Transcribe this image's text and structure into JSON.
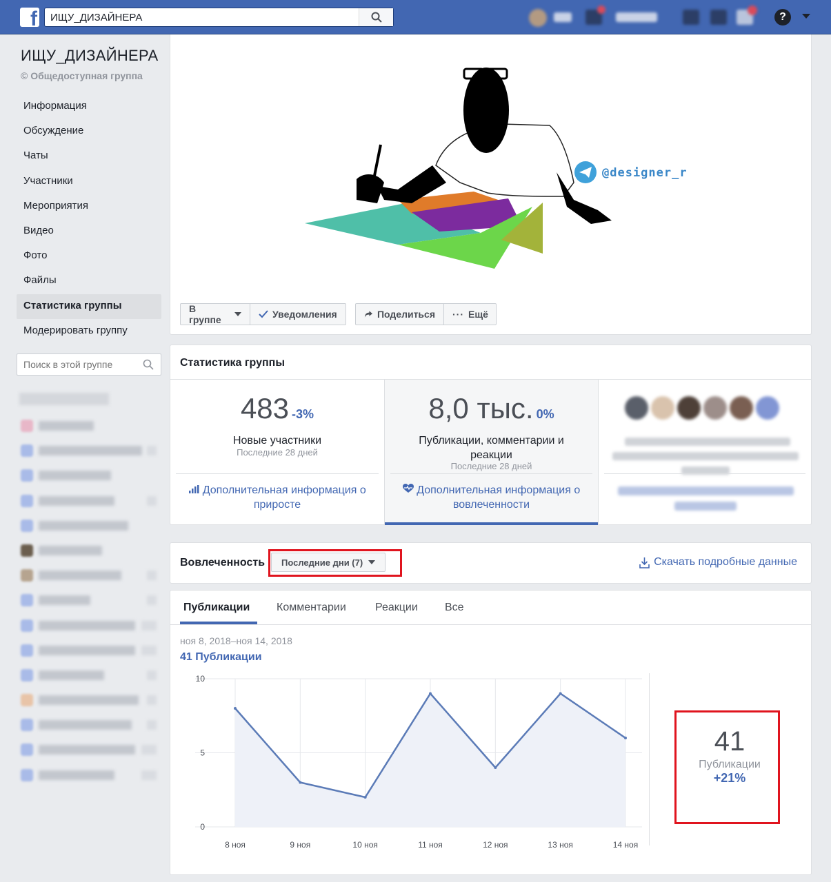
{
  "topbar": {
    "search_value": "ИЩУ_ДИЗАЙНЕРА"
  },
  "group": {
    "title": "ИЩУ_ДИЗАЙНЕРА",
    "privacy": "Общедоступная группа"
  },
  "nav": {
    "items": [
      "Информация",
      "Обсуждение",
      "Чаты",
      "Участники",
      "Мероприятия",
      "Видео",
      "Фото",
      "Файлы",
      "Статистика группы",
      "Модерировать группу"
    ],
    "active_index": 8
  },
  "group_search": {
    "placeholder": "Поиск в этой группе"
  },
  "cover": {
    "telegram_handle": "@designer_ru"
  },
  "cover_buttons": {
    "joined": "В группе",
    "notifications": "Уведомления",
    "share": "Поделиться",
    "more": "Ещё"
  },
  "stats": {
    "title": "Статистика группы",
    "members": {
      "value": "483",
      "change": "-3%",
      "label": "Новые участники",
      "period": "Последние 28 дней",
      "link": "Дополнительная информация о приросте"
    },
    "engagement": {
      "value": "8,0 тыс.",
      "change": "0%",
      "label": "Публикации, комментарии и реакции",
      "period": "Последние 28 дней",
      "link": "Дополнительная информация о вовлеченности"
    }
  },
  "engagement_header": {
    "title": "Вовлеченность",
    "range_select": "Последние дни (7)",
    "download": "Скачать подробные данные"
  },
  "tabs": [
    "Публикации",
    "Комментарии",
    "Реакции",
    "Все"
  ],
  "chart_header": {
    "date_range": "ноя 8, 2018–ноя 14, 2018",
    "summary": "41 Публикации"
  },
  "chart_data": {
    "type": "area",
    "categories": [
      "8 ноя",
      "9 ноя",
      "10 ноя",
      "11 ноя",
      "12 ноя",
      "13 ноя",
      "14 ноя"
    ],
    "values": [
      8,
      3,
      2,
      9,
      4,
      9,
      6
    ],
    "ylim": [
      0,
      10
    ],
    "yticks": [
      "0",
      "5",
      "10"
    ],
    "grid": true,
    "colors": {
      "line": "#5b7bb7",
      "fill": "#eef1f8"
    }
  },
  "kpi": {
    "value": "41",
    "label": "Публикации",
    "change": "+21%"
  },
  "colors": {
    "brand": "#4267b2",
    "highlight": "#e0141e"
  }
}
